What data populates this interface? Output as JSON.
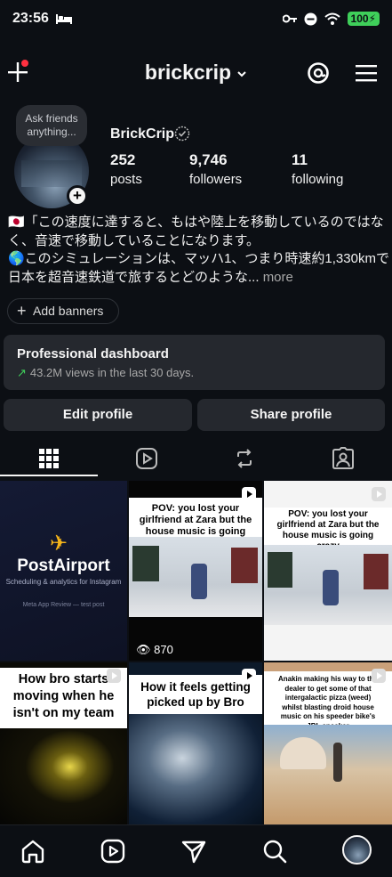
{
  "status": {
    "time": "23:56",
    "battery": "100"
  },
  "header": {
    "username": "brickcrip"
  },
  "note": {
    "text": "Ask friends anything..."
  },
  "profile": {
    "display_name": "BrickCrip",
    "posts_count": "252",
    "posts_label": "posts",
    "followers_count": "9,746",
    "followers_label": "followers",
    "following_count": "11",
    "following_label": "following"
  },
  "bio": {
    "line1": "🇯🇵「この速度に達すると、もはや陸上を移動しているのではなく、音速で移動していることになります。",
    "line2": "🌎このシミュレーションは、マッハ1、つまり時速約1,330kmで日本を超音速鉄道で旅するとどのような...",
    "more": "more"
  },
  "banners": {
    "label": "Add banners"
  },
  "dashboard": {
    "title": "Professional dashboard",
    "subtitle": "43.2M views in the last 30 days."
  },
  "buttons": {
    "edit": "Edit profile",
    "share": "Share profile"
  },
  "tabs": [
    {
      "icon": "grid-icon",
      "active": true
    },
    {
      "icon": "reels-icon",
      "active": false
    },
    {
      "icon": "reposts-icon",
      "active": false
    },
    {
      "icon": "tagged-icon",
      "active": false
    }
  ],
  "posts": [
    {
      "title": "PostAirport",
      "subtitle": "Scheduling & analytics for Instagram",
      "small": "Meta App Review — test post"
    },
    {
      "caption": "POV: you lost your girlfriend at Zara but the house music is going crazy",
      "views": "870"
    },
    {
      "caption": "POV: you lost your girlfriend at Zara but the house music is going crazy"
    },
    {
      "caption": "How bro starts moving when he isn't on my team"
    },
    {
      "caption": "How it feels getting picked up by Bro"
    },
    {
      "caption": "Anakin making his way to the dealer to get some of that intergalactic pizza (weed) whilst blasting droid house music on his speeder bike's JBL speaker"
    }
  ],
  "colors": {
    "bg": "#0c0f14",
    "card": "#25282e",
    "accent_green": "#3fcf5a",
    "notification_red": "#ff3040"
  },
  "nav": [
    "home-icon",
    "reels-icon",
    "send-icon",
    "search-icon",
    "profile-avatar"
  ]
}
